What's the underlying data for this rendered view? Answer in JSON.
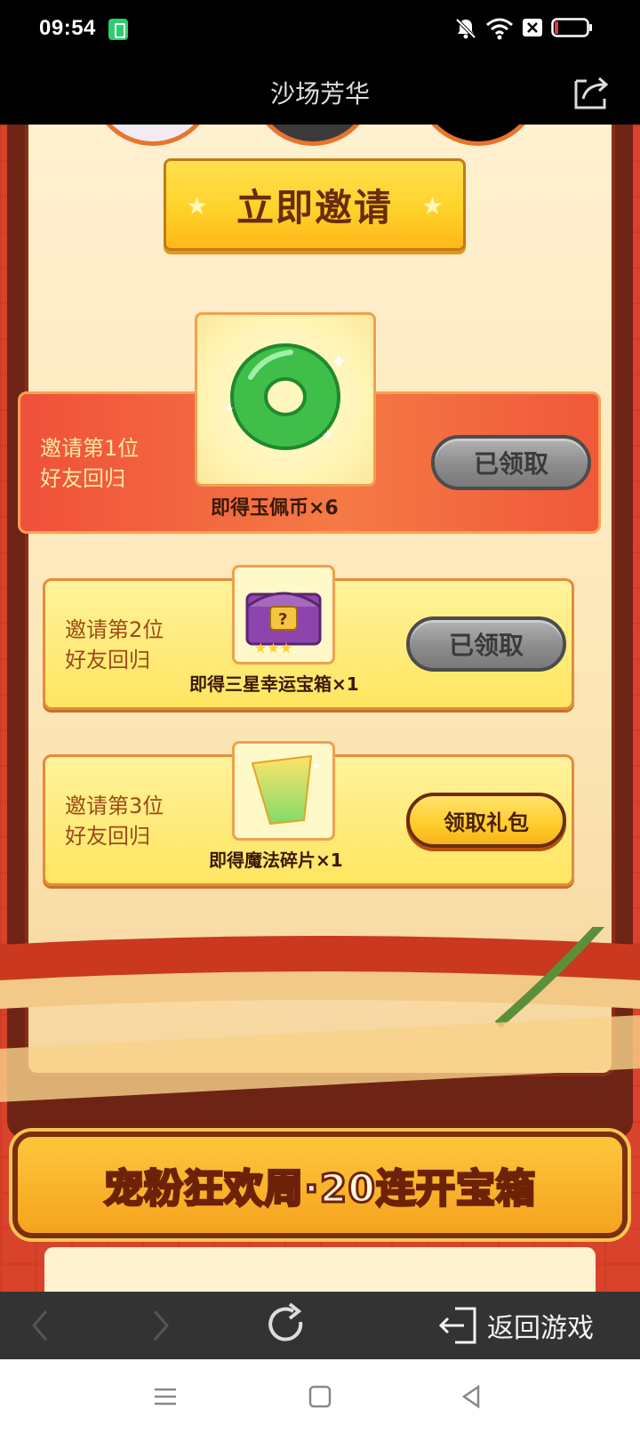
{
  "status_bar": {
    "time": "09:54",
    "icons": [
      "battery-saver-icon",
      "mute-bell-icon",
      "wifi-icon",
      "sim-x-icon",
      "battery-icon"
    ]
  },
  "header": {
    "title": "沙场芳华",
    "share_icon": "share-icon"
  },
  "invite": {
    "button_label": "立即邀请"
  },
  "rewards": [
    {
      "condition_line1": "邀请第1位",
      "condition_line2": "好友回归",
      "item": "即得玉佩币×6",
      "item_icon": "jade-coin-icon",
      "button": "已领取",
      "state": "claimed"
    },
    {
      "condition_line1": "邀请第2位",
      "condition_line2": "好友回归",
      "item": "即得三星幸运宝箱×1",
      "item_icon": "treasure-chest-icon",
      "button": "已领取",
      "state": "claimed"
    },
    {
      "condition_line1": "邀请第3位",
      "condition_line2": "好友回归",
      "item": "即得魔法碎片×1",
      "item_icon": "magic-shard-icon",
      "button": "领取礼包",
      "state": "available"
    }
  ],
  "banner": {
    "title": "宠粉狂欢周·20连开宝箱"
  },
  "browser_nav": {
    "back_to_game": "返回游戏"
  },
  "colors": {
    "accent_red": "#d9432b",
    "accent_gold": "#ffd22a",
    "claimed_gray": "#8c8c8c"
  }
}
